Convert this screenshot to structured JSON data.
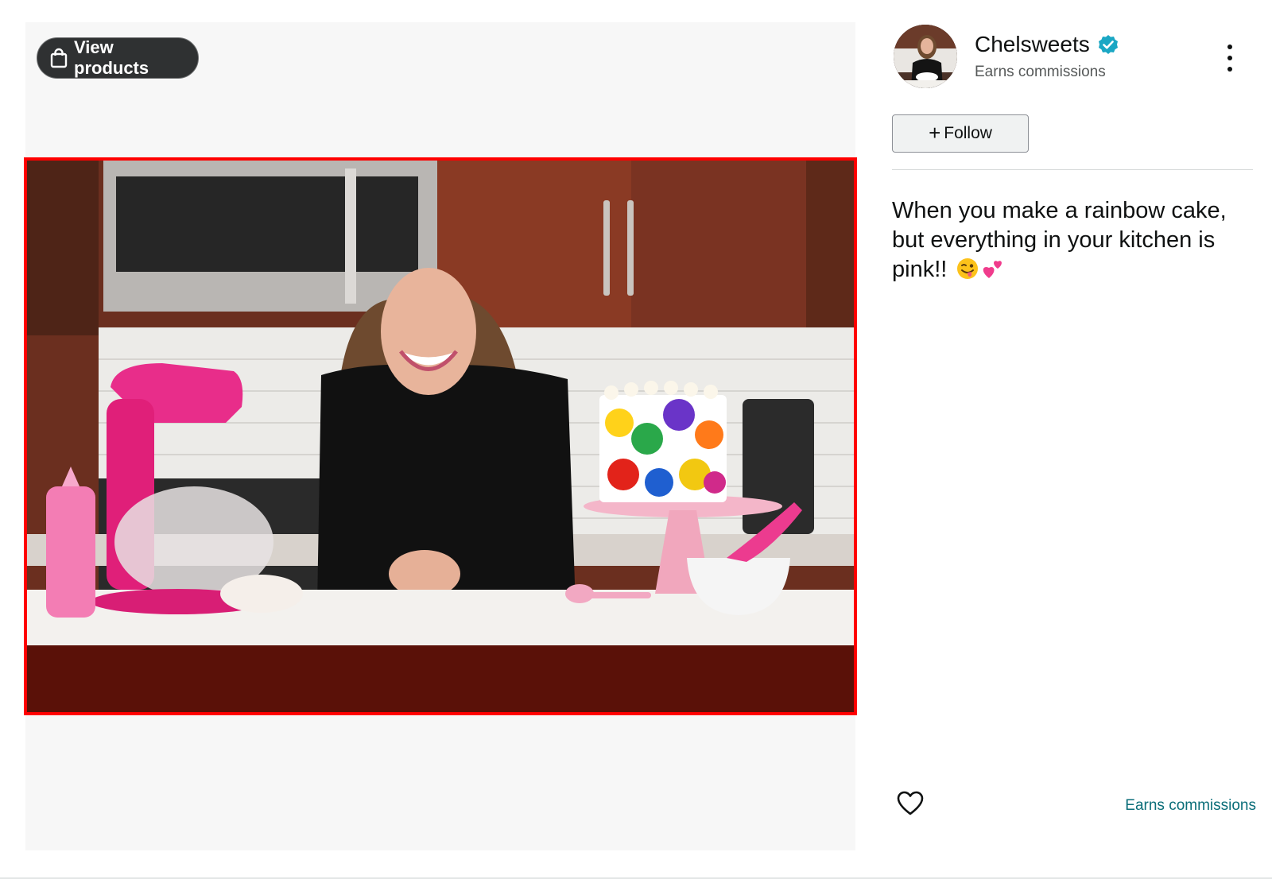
{
  "media": {
    "view_products_label": "View products",
    "bag_icon": "shopping-bag-icon"
  },
  "creator": {
    "name": "Chelsweets",
    "verified_icon": "verified-check-icon",
    "subtitle": "Earns commissions",
    "more_icon": "more-vertical-icon"
  },
  "follow": {
    "label": "Follow",
    "icon": "plus-icon"
  },
  "post": {
    "caption": "When you make a rainbow cake, but everything in your kitchen is pink!!",
    "emojis": [
      "winking-face-with-tongue-emoji",
      "two-hearts-emoji"
    ]
  },
  "footer": {
    "like_icon": "heart-outline-icon",
    "earns_label": "Earns commissions"
  },
  "colors": {
    "accent_teal": "#0b6e79",
    "verified_blue": "#1ba7c4",
    "highlight_border": "#ff0000",
    "pill_dark": "#2f3132"
  }
}
